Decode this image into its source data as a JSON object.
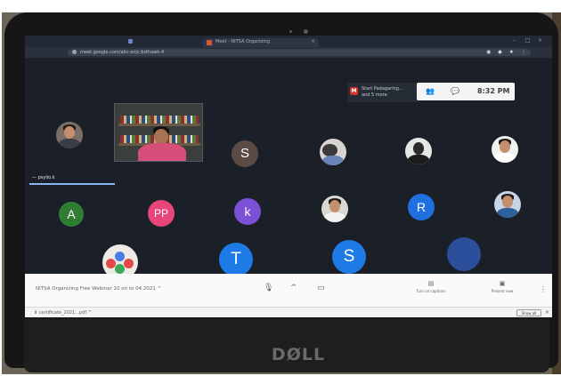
{
  "browser": {
    "tab_title": "Meet - NITSA Organizing",
    "tab_close": "×",
    "url": "meet.google.com/abc-xnjc-bsthxwk-4",
    "window_controls": [
      "–",
      "□",
      "×"
    ],
    "extension_icons": "◉ ◆ ★ ⋮"
  },
  "meet": {
    "notification": {
      "icon": "M",
      "line1": "Start Padagaring...",
      "line2": "and 5 more"
    },
    "top_panel": {
      "people_icon": "👥",
      "chat_icon": "💬",
      "clock": "8:32 PM"
    },
    "self_view": {
      "label": "— psylio.k"
    },
    "participants": [
      {
        "kind": "photo",
        "name": "participant-photo-1"
      },
      {
        "kind": "video",
        "name": "presenter-video"
      },
      {
        "kind": "letter",
        "initial": "S",
        "color": "#5c4a46"
      },
      {
        "kind": "photo",
        "name": "participant-photo-3"
      },
      {
        "kind": "photo",
        "name": "participant-photo-4"
      },
      {
        "kind": "photo",
        "name": "participant-photo-5"
      },
      {
        "kind": "letter",
        "initial": "A",
        "color": "#2f7d32"
      },
      {
        "kind": "letter",
        "initial": "PP",
        "color": "#e8457a"
      },
      {
        "kind": "letter",
        "initial": "k",
        "color": "#7b4fd6"
      },
      {
        "kind": "photo",
        "name": "participant-photo-9"
      },
      {
        "kind": "letter",
        "initial": "R",
        "color": "#1f6fe0"
      },
      {
        "kind": "photo",
        "name": "participant-photo-11"
      },
      {
        "kind": "group",
        "name": "participant-group-avatar"
      },
      {
        "kind": "letter",
        "initial": "T",
        "color": "#1e7be6"
      },
      {
        "kind": "letter",
        "initial": "S",
        "color": "#1e7be6"
      },
      {
        "kind": "letter",
        "initial": "",
        "color": "#2b4f9a"
      }
    ],
    "bottom_bar": {
      "title": "NITSA Organizing Free Webinar 10 on to 04.2021  ^",
      "mic_icon": "🎙",
      "hand_icon": "^",
      "camera_icon": "▭",
      "captions_icon": "▤",
      "captions_label": "Turn on captions",
      "present_icon": "▣",
      "present_label": "Present now",
      "more_icon": "⋮"
    }
  },
  "downloads": {
    "item": "⬇  certificate_2021...pdf    ^",
    "show_all": "Show all",
    "close": "×"
  },
  "laptop": {
    "brand": "DØLL"
  }
}
